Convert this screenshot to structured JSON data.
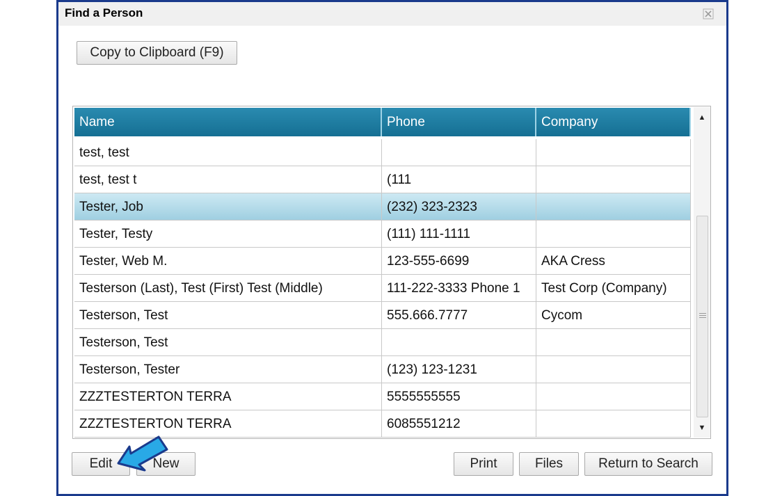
{
  "window": {
    "title": "Find a Person",
    "close_icon": "close-icon"
  },
  "toolbar": {
    "copy_label": "Copy to Clipboard (F9)"
  },
  "grid": {
    "columns": [
      "Name",
      "Phone",
      "Company"
    ],
    "selected_row": 2,
    "rows": [
      {
        "name": "test, test",
        "phone": "",
        "company": ""
      },
      {
        "name": "test, test t",
        "phone": "(111",
        "company": ""
      },
      {
        "name": "Tester, Job",
        "phone": "(232) 323-2323",
        "company": ""
      },
      {
        "name": "Tester, Testy",
        "phone": "(111) 111-1111",
        "company": ""
      },
      {
        "name": "Tester, Web M.",
        "phone": "123-555-6699",
        "company": "AKA Cress"
      },
      {
        "name": "Testerson (Last), Test (First) Test (Middle)",
        "phone": "111-222-3333 Phone 1",
        "company": "Test Corp (Company)"
      },
      {
        "name": "Testerson, Test",
        "phone": "555.666.7777",
        "company": "Cycom"
      },
      {
        "name": "Testerson, Test",
        "phone": "",
        "company": ""
      },
      {
        "name": "Testerson, Tester",
        "phone": "(123) 123-1231",
        "company": ""
      },
      {
        "name": "ZZZTESTERTON TERRA",
        "phone": "5555555555",
        "company": ""
      },
      {
        "name": "ZZZTESTERTON TERRA",
        "phone": "6085551212",
        "company": ""
      }
    ],
    "scroll_icons": [
      "scroll-up-icon",
      "scroll-down-icon"
    ]
  },
  "footer": {
    "edit_label": "Edit",
    "new_label": "New",
    "print_label": "Print",
    "files_label": "Files",
    "return_label": "Return to Search"
  },
  "annotation": {
    "icon": "arrow-pointer-icon",
    "color": "#29a9e6",
    "outline": "#1a3a8c"
  },
  "colors": {
    "header": "#1e7ea3",
    "selected_row": "#b5dcea",
    "window_border": "#1a3a8c"
  }
}
